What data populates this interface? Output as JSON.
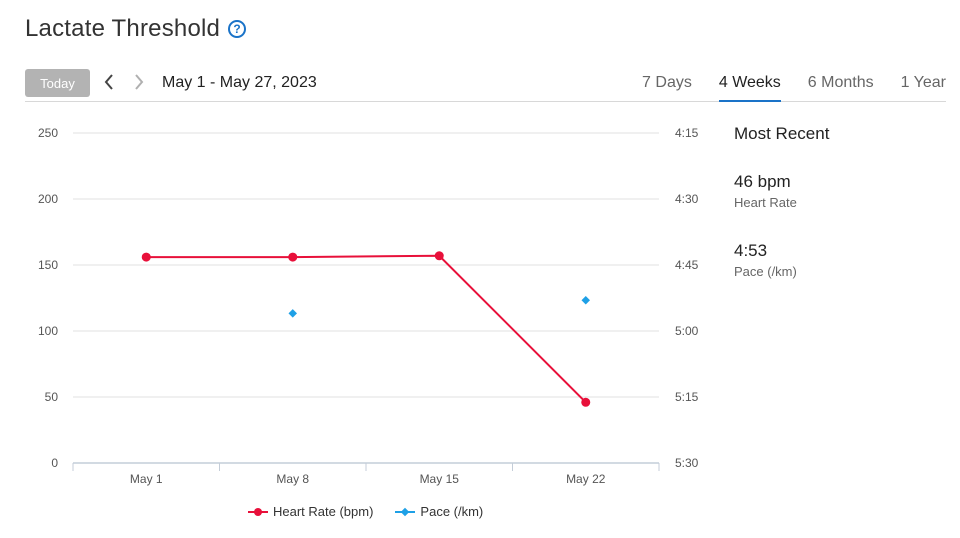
{
  "page": {
    "title": "Lactate Threshold",
    "help_icon": "question-circle-icon"
  },
  "toolbar": {
    "today_label": "Today",
    "date_range": "May 1 - May 27, 2023",
    "prev_icon": "chevron-left-icon",
    "next_icon": "chevron-right-icon",
    "tabs": [
      {
        "label": "7 Days",
        "active": false
      },
      {
        "label": "4 Weeks",
        "active": true
      },
      {
        "label": "6 Months",
        "active": false
      },
      {
        "label": "1 Year",
        "active": false
      }
    ]
  },
  "summary": {
    "title": "Most Recent",
    "heart_rate": {
      "value": "46 bpm",
      "label": "Heart Rate"
    },
    "pace": {
      "value": "4:53",
      "label": "Pace (/km)"
    }
  },
  "colors": {
    "heart_rate": "#e8103a",
    "pace": "#1ea0e6",
    "accent": "#1a73c8",
    "grid": "#e2e2e2"
  },
  "chart_data": {
    "type": "line",
    "categories": [
      "May 1",
      "May 8",
      "May 15",
      "May 22"
    ],
    "y_left": {
      "ticks": [
        "250",
        "200",
        "150",
        "100",
        "50",
        "0"
      ],
      "ylim": [
        0,
        250
      ]
    },
    "y_right": {
      "ticks": [
        "4:15",
        "4:30",
        "4:45",
        "5:00",
        "5:15",
        "5:30"
      ],
      "range_seconds": [
        255,
        330
      ]
    },
    "series": [
      {
        "name": "Heart Rate (bpm)",
        "axis": "left",
        "marker": "circle",
        "x": [
          "May 1",
          "May 8",
          "May 15",
          "May 22"
        ],
        "values": [
          156,
          156,
          157,
          46
        ]
      },
      {
        "name": "Pace (/km)",
        "axis": "right",
        "marker": "diamond",
        "x": [
          "May 8",
          "May 22"
        ],
        "values_seconds": [
          296,
          293
        ],
        "values": [
          "4:56",
          "4:53"
        ]
      }
    ],
    "legend": "bottom",
    "grid": true
  }
}
